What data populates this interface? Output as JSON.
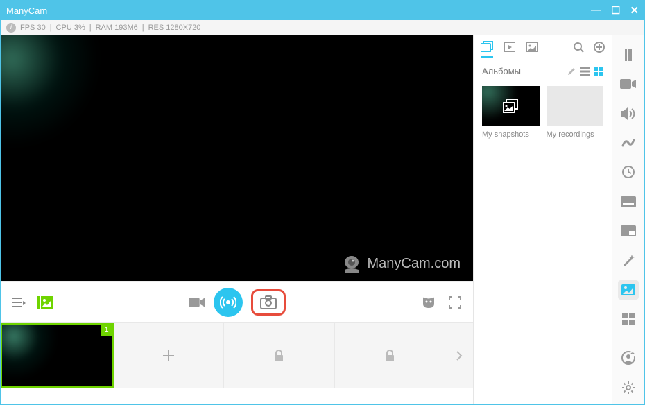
{
  "title": "ManyCam",
  "status": {
    "fps": "FPS 30",
    "cpu": "CPU 3%",
    "ram": "RAM 193M6",
    "res": "RES 1280X720"
  },
  "watermark": "ManyCam.com",
  "rightPane": {
    "albumsLabel": "Альбомы",
    "items": [
      {
        "label": "My snapshots"
      },
      {
        "label": "My recordings"
      }
    ]
  },
  "presets": {
    "activeNumber": "1"
  }
}
